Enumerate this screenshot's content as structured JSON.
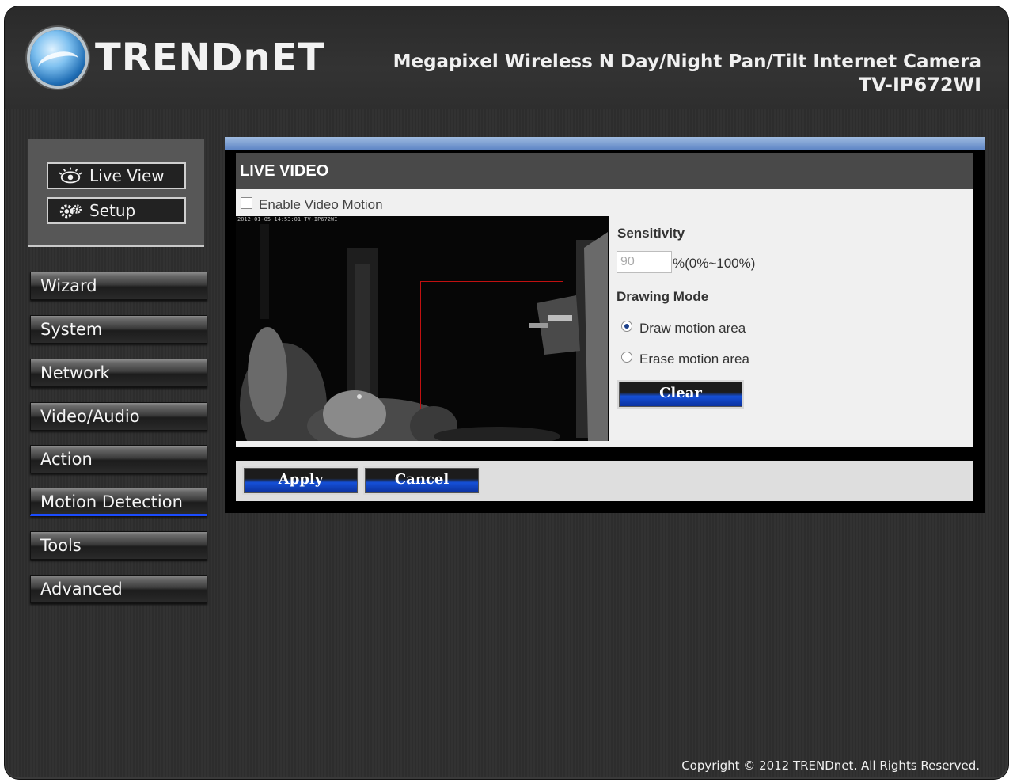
{
  "brand": {
    "logo_text": "TRENDnET"
  },
  "header": {
    "product_title": "Megapixel Wireless N Day/Night Pan/Tilt Internet Camera",
    "product_model": "TV-IP672WI"
  },
  "view_buttons": {
    "live_view": "Live View",
    "setup": "Setup"
  },
  "sidebar": {
    "items": [
      {
        "label": "Wizard",
        "active": false
      },
      {
        "label": "System",
        "active": false
      },
      {
        "label": "Network",
        "active": false
      },
      {
        "label": "Video/Audio",
        "active": false
      },
      {
        "label": "Action",
        "active": false
      },
      {
        "label": "Motion Detection",
        "active": true
      },
      {
        "label": "Tools",
        "active": false
      },
      {
        "label": "Advanced",
        "active": false
      }
    ]
  },
  "main": {
    "section_title": "LIVE VIDEO",
    "enable_label": "Enable Video Motion",
    "enable_checked": false,
    "video_timestamp": "2012-01-05 14:53:01  TV-IP672WI",
    "sensitivity_label": "Sensitivity",
    "sensitivity_value": "90",
    "sensitivity_range": "%(0%~100%)",
    "drawing_mode_label": "Drawing Mode",
    "draw_label": "Draw motion area",
    "erase_label": "Erase motion area",
    "selected_mode": "draw",
    "clear_label": "Clear",
    "apply_label": "Apply",
    "cancel_label": "Cancel"
  },
  "footer": {
    "copyright": "Copyright © 2012 TRENDnet. All Rights Reserved."
  },
  "colors": {
    "accent_blue": "#1550d8",
    "motion_box": "#c01010",
    "background": "#2e2e2e"
  },
  "icons": {
    "live_view": "eye-icon",
    "setup": "gears-icon"
  }
}
